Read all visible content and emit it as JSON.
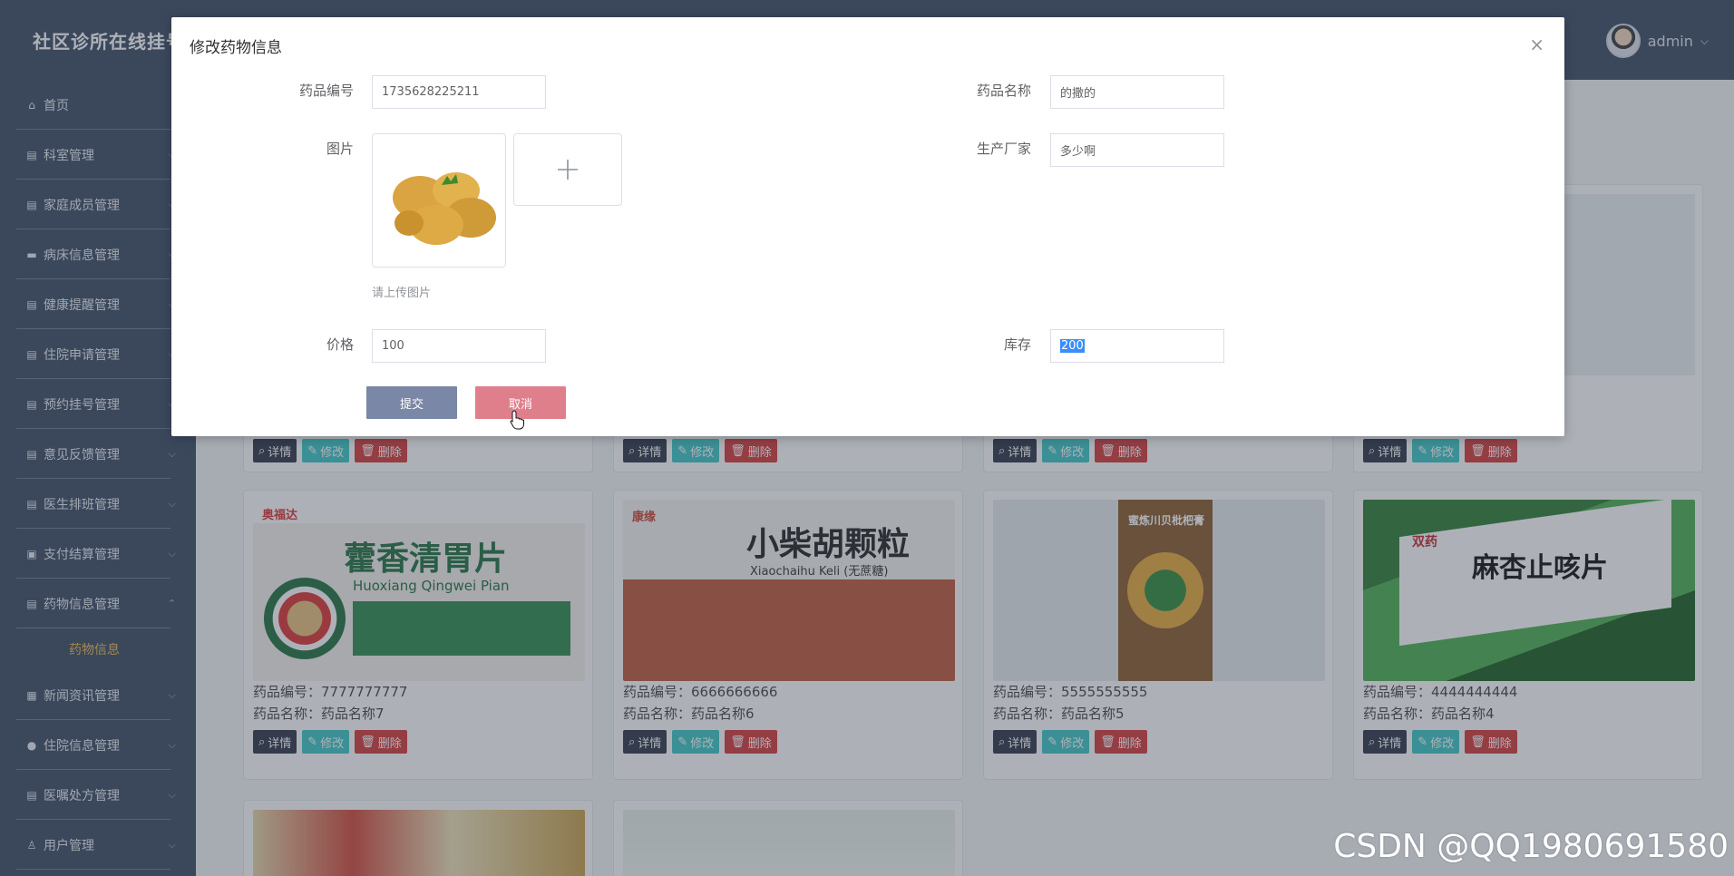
{
  "app": {
    "title": "社区诊所在线挂号"
  },
  "user": {
    "name": "admin"
  },
  "sidebar": {
    "items": [
      {
        "label": "首页",
        "icon": "home-icon"
      },
      {
        "label": "科室管理",
        "icon": "list-icon"
      },
      {
        "label": "家庭成员管理",
        "icon": "list-icon"
      },
      {
        "label": "病床信息管理",
        "icon": "bed-icon"
      },
      {
        "label": "健康提醒管理",
        "icon": "list-icon"
      },
      {
        "label": "住院申请管理",
        "icon": "list-icon"
      },
      {
        "label": "预约挂号管理",
        "icon": "list-icon"
      },
      {
        "label": "意见反馈管理",
        "icon": "list-icon"
      },
      {
        "label": "医生排班管理",
        "icon": "list-icon"
      },
      {
        "label": "支付结算管理",
        "icon": "printer-icon"
      },
      {
        "label": "药物信息管理",
        "icon": "list-icon",
        "expanded": true,
        "sub": "药物信息"
      },
      {
        "label": "新闻资讯管理",
        "icon": "news-icon"
      },
      {
        "label": "住院信息管理",
        "icon": "circle-icon"
      },
      {
        "label": "医嘱处方管理",
        "icon": "list-icon"
      },
      {
        "label": "用户管理",
        "icon": "user-icon"
      }
    ]
  },
  "cards": {
    "detail_label": "详情",
    "edit_label": "修改",
    "delete_label": "删除",
    "code_prefix": "药品编号：",
    "name_prefix": "药品名称：",
    "row2": [
      {
        "code": "7777777777",
        "name": "药品名称7",
        "box_title": "藿香清胃片",
        "box_sub": "Huoxiang Qingwei Pian",
        "brand": "奥福达"
      },
      {
        "code": "6666666666",
        "name": "药品名称6",
        "box_title": "小柴胡颗粒",
        "box_sub": "Xiaochaihu Keli (无蔗糖)",
        "brand": "康缘"
      },
      {
        "code": "5555555555",
        "name": "药品名称5",
        "box_title": "蜜炼川贝枇杷膏",
        "box_sub": "",
        "brand": ""
      },
      {
        "code": "4444444444",
        "name": "药品名称4",
        "box_title": "麻杏止咳片",
        "box_sub": "",
        "brand": "双药"
      }
    ]
  },
  "dialog": {
    "title": "修改药物信息",
    "fields": {
      "code_label": "药品编号",
      "code_value": "1735628225211",
      "name_label": "药品名称",
      "name_value": "的撒的",
      "image_label": "图片",
      "maker_label": "生产厂家",
      "maker_value": "多少啊",
      "upload_hint": "请上传图片",
      "price_label": "价格",
      "price_value": "100",
      "stock_label": "库存",
      "stock_value": "200"
    },
    "submit_label": "提交",
    "cancel_label": "取消"
  },
  "watermark": "CSDN @QQ1980691580",
  "colors": {
    "header_bg": "#3c4a63",
    "submit": "#7a87a6",
    "cancel": "#e07f8c",
    "active_sub": "#e9b94e"
  }
}
